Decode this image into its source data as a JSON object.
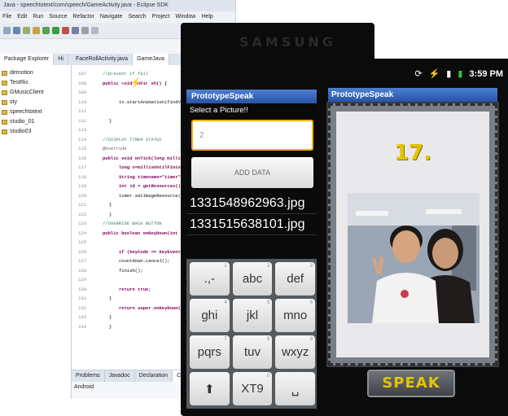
{
  "eclipse": {
    "title": "Java - speechtotext/com/speech/GameActivity.java - Eclipse SDK",
    "menu": [
      "File",
      "Edit",
      "Run",
      "Source",
      "Refactor",
      "Navigate",
      "Search",
      "Project",
      "Window",
      "Help"
    ],
    "package_explorer": {
      "tab_label": "Package Explorer",
      "hierarchy_label": "Hi",
      "items": [
        "demotion",
        "TestRic",
        "GMusicClient",
        "sty",
        "speechtotext",
        "studio_01",
        "studio03"
      ]
    },
    "editor": {
      "tabs": [
        "FaceRollActivity.java",
        "GameJava"
      ],
      "lines": [
        {
          "n": "107",
          "text": "//prevent if fail"
        },
        {
          "n": "108",
          "text": "public void onFinish() {"
        },
        {
          "n": "109",
          "text": ""
        },
        {
          "n": "110",
          "text": "tv.startAnimation(findViewById(R.id"
        },
        {
          "n": "111",
          "text": ""
        },
        {
          "n": "112",
          "text": "}"
        },
        {
          "n": "113",
          "text": ""
        },
        {
          "n": "114",
          "text": "//DISPLAY TIMER STATUS"
        },
        {
          "n": "115",
          "text": "@Override"
        },
        {
          "n": "116",
          "text": "public void onTick(long millisUntilFi"
        },
        {
          "n": "117",
          "text": "long s=millisUntilFinished/1000;"
        },
        {
          "n": "118",
          "text": "String timename=\"timer\"+s;"
        },
        {
          "n": "119",
          "text": "int id = getResources().getIdentifie"
        },
        {
          "n": "120",
          "text": "timer.setImageResource(id);"
        },
        {
          "n": "121",
          "text": "}"
        },
        {
          "n": "122",
          "text": "}"
        },
        {
          "n": "123",
          "text": "//OVERRIDE BACK BUTTON"
        },
        {
          "n": "124",
          "text": "public boolean onKeyDown(int keyCode, Ke"
        },
        {
          "n": "125",
          "text": ""
        },
        {
          "n": "126",
          "text": "if (keyCode == KeyEvent.KEYCODE_BACK"
        },
        {
          "n": "127",
          "text": "countdown.cancel();"
        },
        {
          "n": "128",
          "text": "finish();"
        },
        {
          "n": "129",
          "text": ""
        },
        {
          "n": "130",
          "text": "return true;"
        },
        {
          "n": "131",
          "text": "}"
        },
        {
          "n": "132",
          "text": "return super.onKeyDown(keyCode, eve"
        },
        {
          "n": "133",
          "text": "}"
        },
        {
          "n": "134",
          "text": "}"
        }
      ]
    },
    "console": {
      "tabs": [
        "Problems",
        "Javadoc",
        "Declaration",
        "Console"
      ],
      "status": "Android"
    }
  },
  "samsung": {
    "brand": "SAMSUNG",
    "app_title": "PrototypeSpeak",
    "subheading": "Select a Picture!!",
    "input_value": "2",
    "add_button": "ADD DATA",
    "files": [
      "1331548962963.jpg",
      "1331515638101.jpg"
    ],
    "keypad": [
      {
        "label": ".,-",
        "num": "1"
      },
      {
        "label": "abc",
        "num": "2"
      },
      {
        "label": "def",
        "num": "3"
      },
      {
        "label": "ghi",
        "num": "4"
      },
      {
        "label": "jkl",
        "num": "5"
      },
      {
        "label": "mno",
        "num": "6"
      },
      {
        "label": "pqrs",
        "num": "7"
      },
      {
        "label": "tuv",
        "num": "8"
      },
      {
        "label": "wxyz",
        "num": "9"
      },
      {
        "label": "⬆",
        "num": ""
      },
      {
        "label": "XT9",
        "num": "0"
      },
      {
        "label": "␣",
        "num": ""
      }
    ]
  },
  "phone2": {
    "time": "3:59 PM",
    "app_title": "PrototypeSpeak",
    "score": "17.",
    "speak_button": "SPEAK"
  },
  "colors": {
    "titlebar": "#2f5fb4",
    "score": "#e6c400",
    "input_border": "#ffb000"
  }
}
